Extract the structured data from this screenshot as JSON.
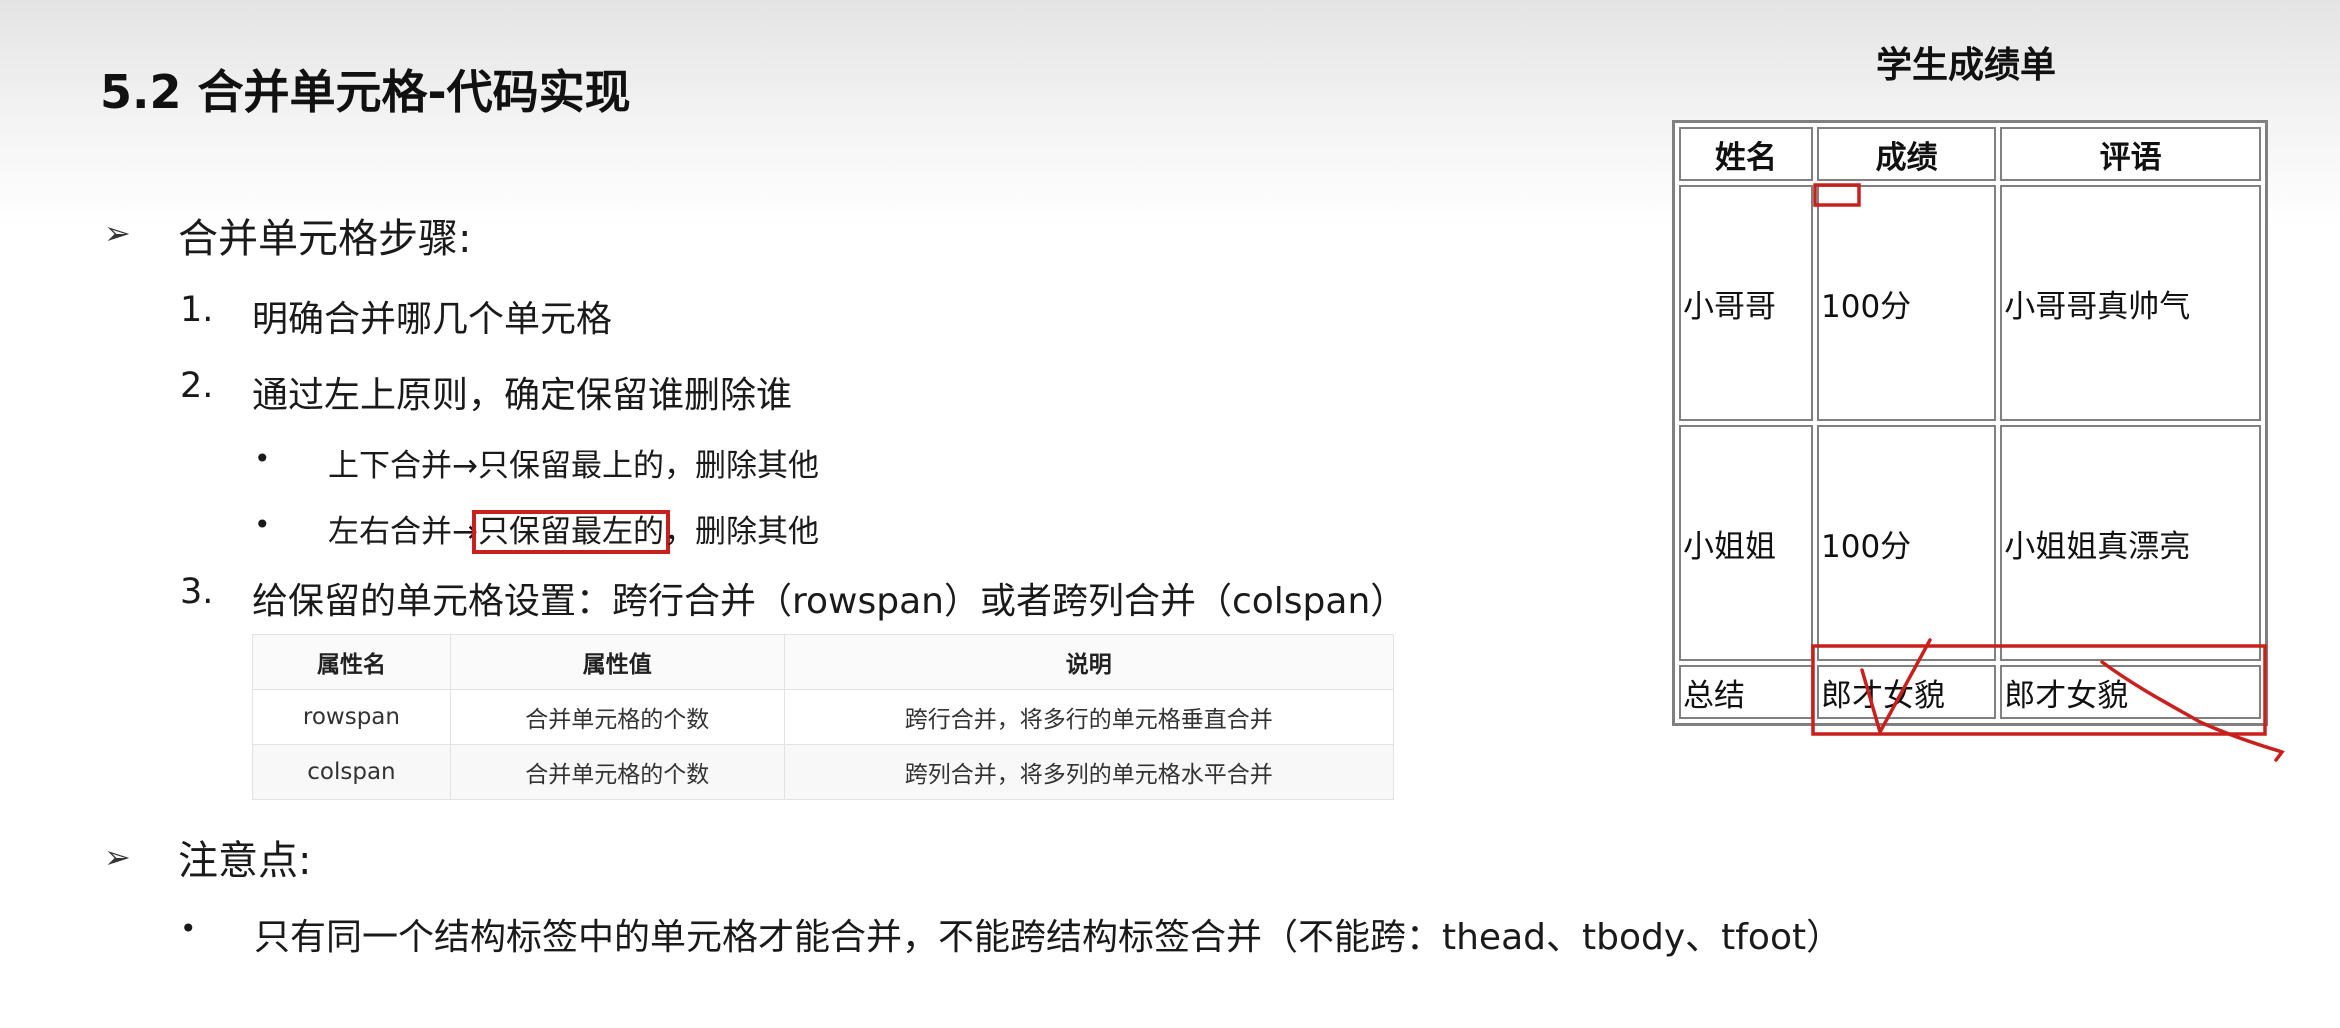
{
  "slide": {
    "title": "5.2 合并单元格-代码实现",
    "arrow_bullet": "➢",
    "steps_heading": "合并单元格步骤:",
    "steps": [
      {
        "num": "1.",
        "text": "明确合并哪几个单元格"
      },
      {
        "num": "2.",
        "text": "通过左上原则，确定保留谁删除谁"
      },
      {
        "num": "3.",
        "text": "给保留的单元格设置：跨行合并（rowspan）或者跨列合并（colspan）"
      }
    ],
    "sub_bullet": "•",
    "sub_points": [
      {
        "text": "上下合并→只保留最上的，删除其他"
      },
      {
        "pre": "左右合并→",
        "highlight": "只保留最左的",
        "post": "，删除其他"
      }
    ],
    "notes_heading": "注意点:",
    "notes": [
      "只有同一个结构标签中的单元格才能合并，不能跨结构标签合并（不能跨：thead、tbody、tfoot）"
    ]
  },
  "attr_table": {
    "headers": [
      "属性名",
      "属性值",
      "说明"
    ],
    "rows": [
      [
        "rowspan",
        "合并单元格的个数",
        "跨行合并，将多行的单元格垂直合并"
      ],
      [
        "colspan",
        "合并单元格的个数",
        "跨列合并，将多列的单元格水平合并"
      ]
    ]
  },
  "score_table": {
    "caption": "学生成绩单",
    "headers": [
      "姓名",
      "成绩",
      "评语"
    ],
    "rows": [
      [
        "小哥哥",
        "100分",
        "小哥哥真帅气"
      ],
      [
        "小姐姐",
        "100分",
        "小姐姐真漂亮"
      ]
    ],
    "footer": [
      "总结",
      "郎才女貌",
      "郎才女貌"
    ]
  },
  "colors": {
    "highlight_red": "#c9201c",
    "border_gray": "#808080",
    "attr_table_border": "#e2e2e2"
  }
}
